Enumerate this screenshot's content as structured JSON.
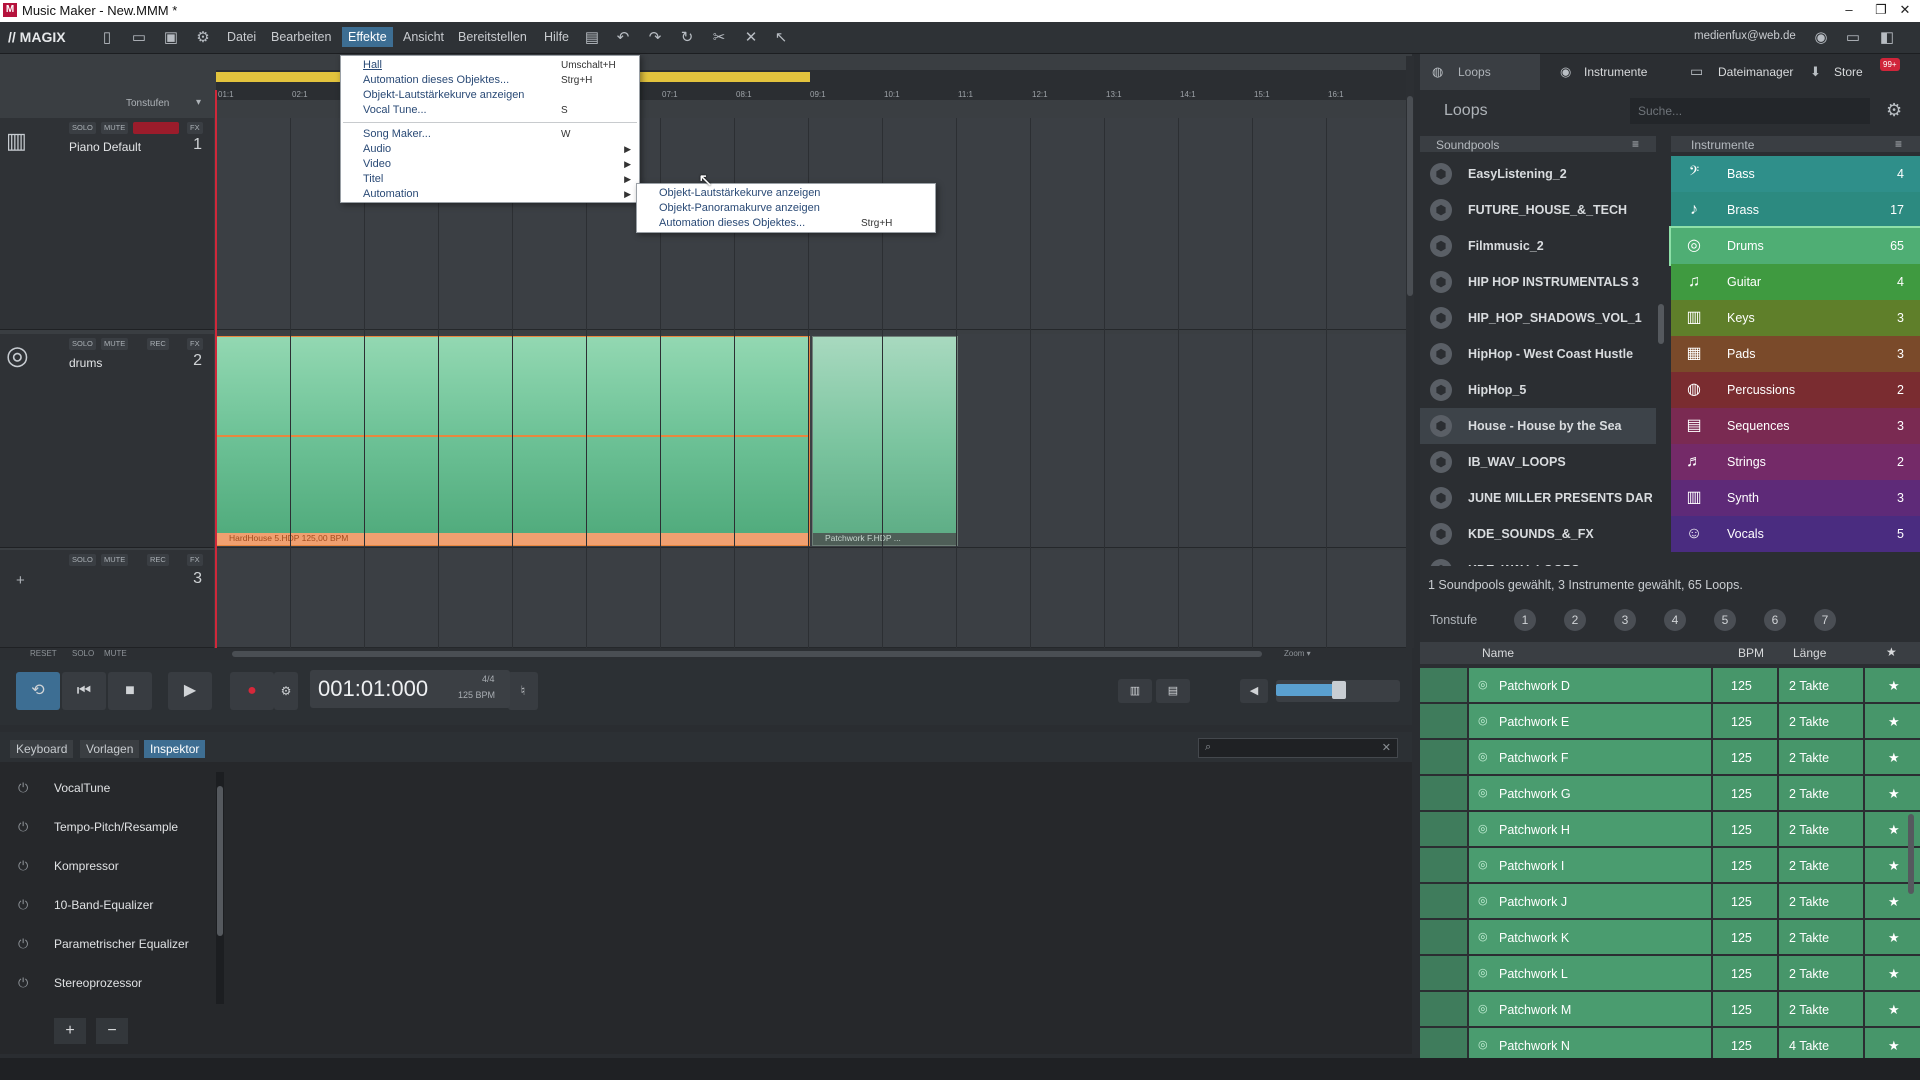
{
  "window": {
    "title": "Music Maker - New.MMM *",
    "logo": "M",
    "min": "–",
    "restore": "❐",
    "close": "✕"
  },
  "menubar": {
    "brand": "// MAGIX",
    "items": [
      "Datei",
      "Bearbeiten",
      "Effekte",
      "Ansicht",
      "Bereitstellen",
      "Hilfe"
    ],
    "active": "Effekte",
    "user": "medienfux@web.de"
  },
  "effects_menu": {
    "items": [
      {
        "label": "Hall",
        "shortcut": "Umschalt+H"
      },
      {
        "label": "Automation dieses Objektes...",
        "shortcut": "Strg+H"
      },
      {
        "label": "Objekt-Lautstärkekurve anzeigen",
        "shortcut": ""
      },
      {
        "label": "Vocal Tune...",
        "shortcut": "S"
      },
      {
        "label": "Song Maker...",
        "shortcut": "W"
      },
      {
        "label": "Audio",
        "shortcut": ""
      },
      {
        "label": "Video",
        "shortcut": ""
      },
      {
        "label": "Titel",
        "shortcut": ""
      },
      {
        "label": "Automation",
        "shortcut": ""
      }
    ],
    "submenu": [
      {
        "label": "Objekt-Lautstärkekurve anzeigen",
        "shortcut": ""
      },
      {
        "label": "Objekt-Panoramakurve anzeigen",
        "shortcut": ""
      },
      {
        "label": "Automation dieses Objektes...",
        "shortcut": "Strg+H"
      }
    ]
  },
  "ruler": {
    "ticks": [
      "01:1",
      "02:1",
      "09:1",
      "10:1",
      "11:1",
      "12:1",
      "13:1",
      "14:1",
      "15:1",
      "16:1",
      "07:1",
      "08:1"
    ],
    "tonstufen_label": "Tonstufen"
  },
  "tracks": [
    {
      "name": "Piano Default",
      "number": "1",
      "buttons": [
        "SOLO",
        "MUTE",
        "",
        "FX"
      ]
    },
    {
      "name": "drums",
      "number": "2",
      "buttons": [
        "SOLO",
        "MUTE",
        "REC",
        "FX"
      ]
    },
    {
      "name": "",
      "number": "3",
      "buttons": [
        "SOLO",
        "MUTE",
        "REC",
        "FX"
      ]
    }
  ],
  "clips": [
    {
      "label": "HardHouse 5.HDP  125,00 BPM"
    },
    {
      "label": "Patchwork F.HDP ..."
    }
  ],
  "track_footer": {
    "reset": "RESET",
    "solo": "SOLO",
    "mute": "MUTE",
    "zoom": "Zoom ▾",
    "add": "+"
  },
  "transport": {
    "timecode": "001:01:000",
    "meter": "4/4",
    "bpm": "125 BPM"
  },
  "lower_tabs": [
    "Keyboard",
    "Vorlagen",
    "Inspektor"
  ],
  "lower_active_tab": "Inspektor",
  "effects_chain": [
    "VocalTune",
    "Tempo-Pitch/Resample",
    "Kompressor",
    "10-Band-Equalizer",
    "Parametrischer Equalizer",
    "Stereoprozessor"
  ],
  "lower_buttons": {
    "add": "+",
    "remove": "−"
  },
  "right_panel": {
    "tabs": [
      "Loops",
      "Instrumente",
      "Dateimanager",
      "Store"
    ],
    "store_badge": "99+",
    "title": "Loops",
    "search_placeholder": "Suche...",
    "soundpools_header": "Soundpools",
    "instrumente_header": "Instrumente",
    "soundpools": [
      {
        "name": "EasyListening_2",
        "selected": false
      },
      {
        "name": "FUTURE_HOUSE_&_TECH",
        "selected": false
      },
      {
        "name": "Filmmusic_2",
        "selected": false
      },
      {
        "name": "HIP HOP INSTRUMENTALS 3",
        "selected": false
      },
      {
        "name": "HIP_HOP_SHADOWS_VOL_1",
        "selected": false
      },
      {
        "name": "HipHop - West Coast Hustle",
        "selected": false
      },
      {
        "name": "HipHop_5",
        "selected": false
      },
      {
        "name": "House - House by the Sea",
        "selected": true
      },
      {
        "name": "IB_WAV_LOOPS",
        "selected": false
      },
      {
        "name": "JUNE MILLER PRESENTS DARK C",
        "selected": false
      },
      {
        "name": "KDE_SOUNDS_&_FX",
        "selected": false
      },
      {
        "name": "KDE_WAV_LOOPS",
        "selected": false
      }
    ],
    "instruments": [
      {
        "name": "Bass",
        "count": "4",
        "color": "#2f8f8a",
        "icon": "bass-icon",
        "glyph": "𝄢"
      },
      {
        "name": "Brass",
        "count": "17",
        "color": "#2c8a80",
        "icon": "brass-icon",
        "glyph": "♪"
      },
      {
        "name": "Drums",
        "count": "65",
        "color": "#4fae74",
        "icon": "drums-icon",
        "glyph": "◎"
      },
      {
        "name": "Guitar",
        "count": "4",
        "color": "#3f9a40",
        "icon": "guitar-icon",
        "glyph": "♫"
      },
      {
        "name": "Keys",
        "count": "3",
        "color": "#5f7f2a",
        "icon": "keys-icon",
        "glyph": "▥"
      },
      {
        "name": "Pads",
        "count": "3",
        "color": "#7a4a2a",
        "icon": "pads-icon",
        "glyph": "▦"
      },
      {
        "name": "Percussions",
        "count": "2",
        "color": "#7a2c30",
        "icon": "percussion-icon",
        "glyph": "◍"
      },
      {
        "name": "Sequences",
        "count": "3",
        "color": "#7a2a52",
        "icon": "sequences-icon",
        "glyph": "▤"
      },
      {
        "name": "Strings",
        "count": "2",
        "color": "#742a68",
        "icon": "strings-icon",
        "glyph": "♬"
      },
      {
        "name": "Synth",
        "count": "3",
        "color": "#5e2a78",
        "icon": "synth-icon",
        "glyph": "▥"
      },
      {
        "name": "Vocals",
        "count": "5",
        "color": "#4a2c80",
        "icon": "vocals-icon",
        "glyph": "☺"
      }
    ],
    "status": "1 Soundpools gewählt, 3 Instrumente gewählt, 65 Loops.",
    "tonstufe_label": "Tonstufe",
    "tonstufen": [
      "1",
      "2",
      "3",
      "4",
      "5",
      "6",
      "7"
    ],
    "columns": {
      "name": "Name",
      "bpm": "BPM",
      "length": "Länge",
      "fav": "★"
    },
    "loops": [
      {
        "name": "Patchwork D",
        "bpm": "125",
        "length": "2 Takte"
      },
      {
        "name": "Patchwork E",
        "bpm": "125",
        "length": "2 Takte"
      },
      {
        "name": "Patchwork F",
        "bpm": "125",
        "length": "2 Takte"
      },
      {
        "name": "Patchwork G",
        "bpm": "125",
        "length": "2 Takte"
      },
      {
        "name": "Patchwork H",
        "bpm": "125",
        "length": "2 Takte"
      },
      {
        "name": "Patchwork I",
        "bpm": "125",
        "length": "2 Takte"
      },
      {
        "name": "Patchwork J",
        "bpm": "125",
        "length": "2 Takte"
      },
      {
        "name": "Patchwork K",
        "bpm": "125",
        "length": "2 Takte"
      },
      {
        "name": "Patchwork L",
        "bpm": "125",
        "length": "2 Takte"
      },
      {
        "name": "Patchwork M",
        "bpm": "125",
        "length": "2 Takte"
      },
      {
        "name": "Patchwork N",
        "bpm": "125",
        "length": "4 Takte"
      }
    ]
  },
  "colors": {
    "accent": "#3d6e93",
    "loop_green": "#4a9c6f",
    "clip_border": "#e8873f"
  }
}
